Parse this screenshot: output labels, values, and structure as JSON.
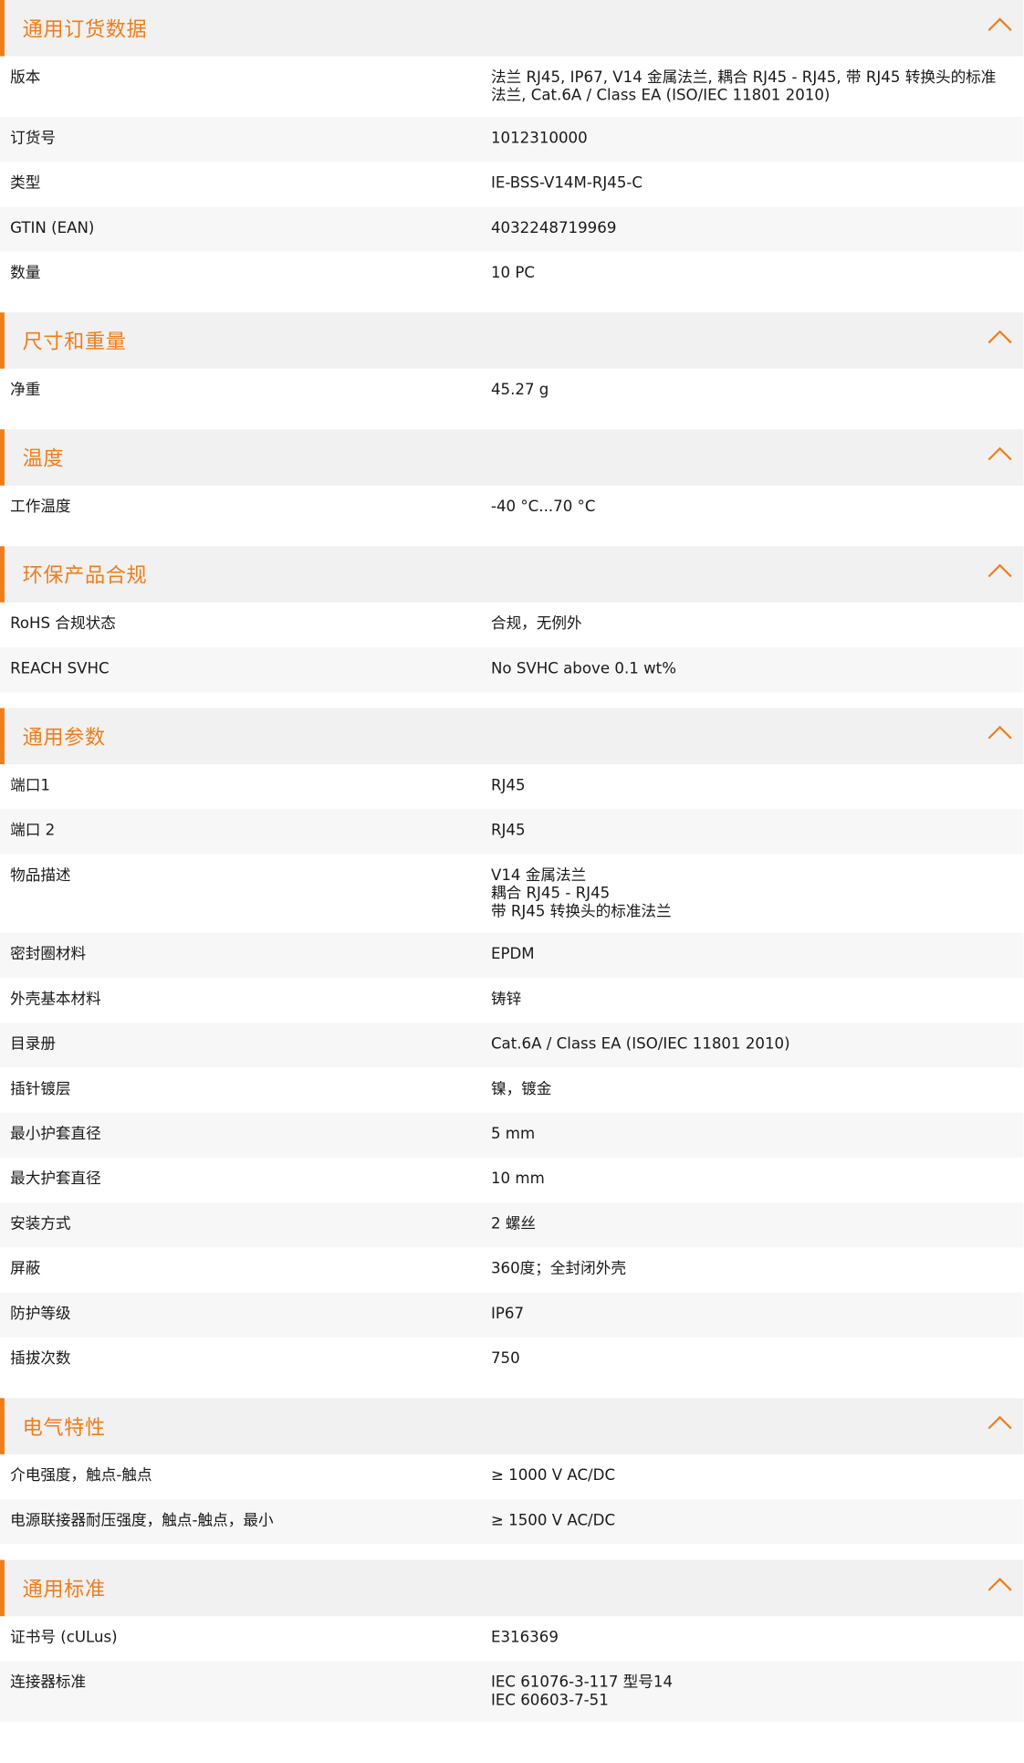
{
  "colors": {
    "accent": "#f07d1a",
    "header_bg": "#f1f1f1",
    "row_alt_bg": "#f7f7f7"
  },
  "sections": [
    {
      "title": "通用订货数据",
      "icon": "chevron-up-icon",
      "rows": [
        {
          "label": "版本",
          "value": "法兰 RJ45, IP67, V14 金属法兰, 耦合 RJ45 - RJ45, 带 RJ45 转换头的标准\n法兰, Cat.6A / Class EA (ISO/IEC 11801 2010)"
        },
        {
          "label": "订货号",
          "value": "1012310000"
        },
        {
          "label": "类型",
          "value": "IE-BSS-V14M-RJ45-C"
        },
        {
          "label": "GTIN (EAN)",
          "value": "4032248719969"
        },
        {
          "label": "数量",
          "value": "10  PC"
        }
      ]
    },
    {
      "title": "尺寸和重量",
      "icon": "chevron-up-icon",
      "rows": [
        {
          "label": "净重",
          "value": "45.27  g"
        }
      ]
    },
    {
      "title": "温度",
      "icon": "chevron-up-icon",
      "rows": [
        {
          "label": "工作温度",
          "value": "-40 °C...70 °C"
        }
      ]
    },
    {
      "title": "环保产品合规",
      "icon": "chevron-up-icon",
      "rows": [
        {
          "label": "RoHS 合规状态",
          "value": "合规，无例外"
        },
        {
          "label": "REACH SVHC",
          "value": "No SVHC above 0.1 wt%"
        }
      ]
    },
    {
      "title": "通用参数",
      "icon": "chevron-up-icon",
      "rows": [
        {
          "label": "端口1",
          "value": "RJ45"
        },
        {
          "label": "端口 2",
          "value": "RJ45"
        },
        {
          "label": "物品描述",
          "value": "V14 金属法兰\n耦合 RJ45 - RJ45\n带 RJ45 转换头的标准法兰"
        },
        {
          "label": "密封圈材料",
          "value": "EPDM"
        },
        {
          "label": "外壳基本材料",
          "value": "铸锌"
        },
        {
          "label": "目录册",
          "value": "Cat.6A / Class EA (ISO/IEC 11801 2010)"
        },
        {
          "label": "插针镀层",
          "value": "镍，镀金"
        },
        {
          "label": "最小护套直径",
          "value": "5  mm"
        },
        {
          "label": "最大护套直径",
          "value": "10  mm"
        },
        {
          "label": "安装方式",
          "value": "2 螺丝"
        },
        {
          "label": "屏蔽",
          "value": "360度；全封闭外壳"
        },
        {
          "label": "防护等级",
          "value": "IP67"
        },
        {
          "label": "插拔次数",
          "value": "750"
        }
      ]
    },
    {
      "title": "电气特性",
      "icon": "chevron-up-icon",
      "rows": [
        {
          "label": "介电强度，触点-触点",
          "value": "≥ 1000 V AC/DC"
        },
        {
          "label": "电源联接器耐压强度，触点-触点，最小",
          "value": "≥ 1500 V AC/DC"
        }
      ]
    },
    {
      "title": "通用标准",
      "icon": "chevron-up-icon",
      "rows": [
        {
          "label": "证书号 (cULus)",
          "value": "E316369"
        },
        {
          "label": "连接器标准",
          "value": "IEC 61076-3-117 型号14\nIEC 60603-7-51"
        }
      ]
    }
  ]
}
